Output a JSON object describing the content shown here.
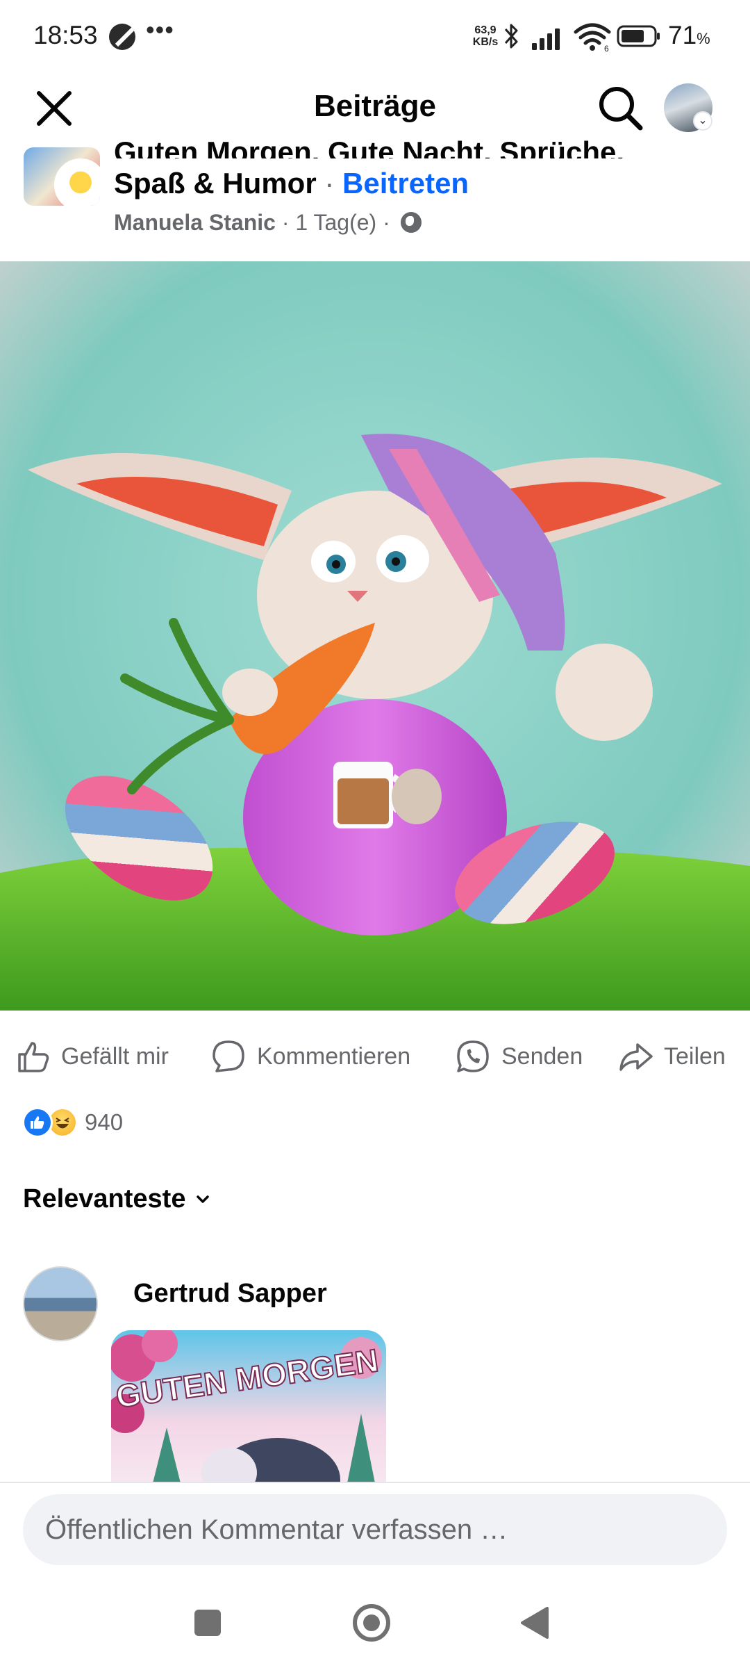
{
  "status_bar": {
    "time": "18:53",
    "more_indicator": "•••",
    "net_speed_value": "63,9",
    "net_speed_unit": "KB/s",
    "battery_percent": "71",
    "battery_unit": "%",
    "icons": [
      "dnd-icon",
      "bluetooth-icon",
      "signal-icon",
      "wifi-icon",
      "battery-icon"
    ]
  },
  "header": {
    "title": "Beiträge",
    "icons": [
      "close-icon",
      "search-icon",
      "profile-avatar",
      "chevron-down-icon"
    ]
  },
  "post": {
    "group_title_line1": "Guten Morgen, Gute Nacht, Sprüche,",
    "group_title_line2": "Spaß & Humor",
    "separator": "·",
    "join_label": "Beitreten",
    "author": "Manuela Stanic",
    "time_ago": "1 Tag(e)",
    "audience_icon": "globe-icon"
  },
  "actions": {
    "like": "Gefällt mir",
    "comment": "Kommentieren",
    "send": "Senden",
    "share": "Teilen"
  },
  "reactions": {
    "count": "940",
    "icons": [
      "like-reaction-icon",
      "haha-reaction-icon"
    ]
  },
  "comments": {
    "sort_label": "Relevanteste",
    "items": [
      {
        "author": "Gertrud Sapper",
        "image_caption": "GUTEN MORGEN"
      }
    ]
  },
  "composer": {
    "placeholder": "Öffentlichen Kommentar verfassen …"
  },
  "colors": {
    "accent": "#0866ff",
    "secondary_text": "#65676b",
    "input_bg": "#f0f2f5"
  }
}
